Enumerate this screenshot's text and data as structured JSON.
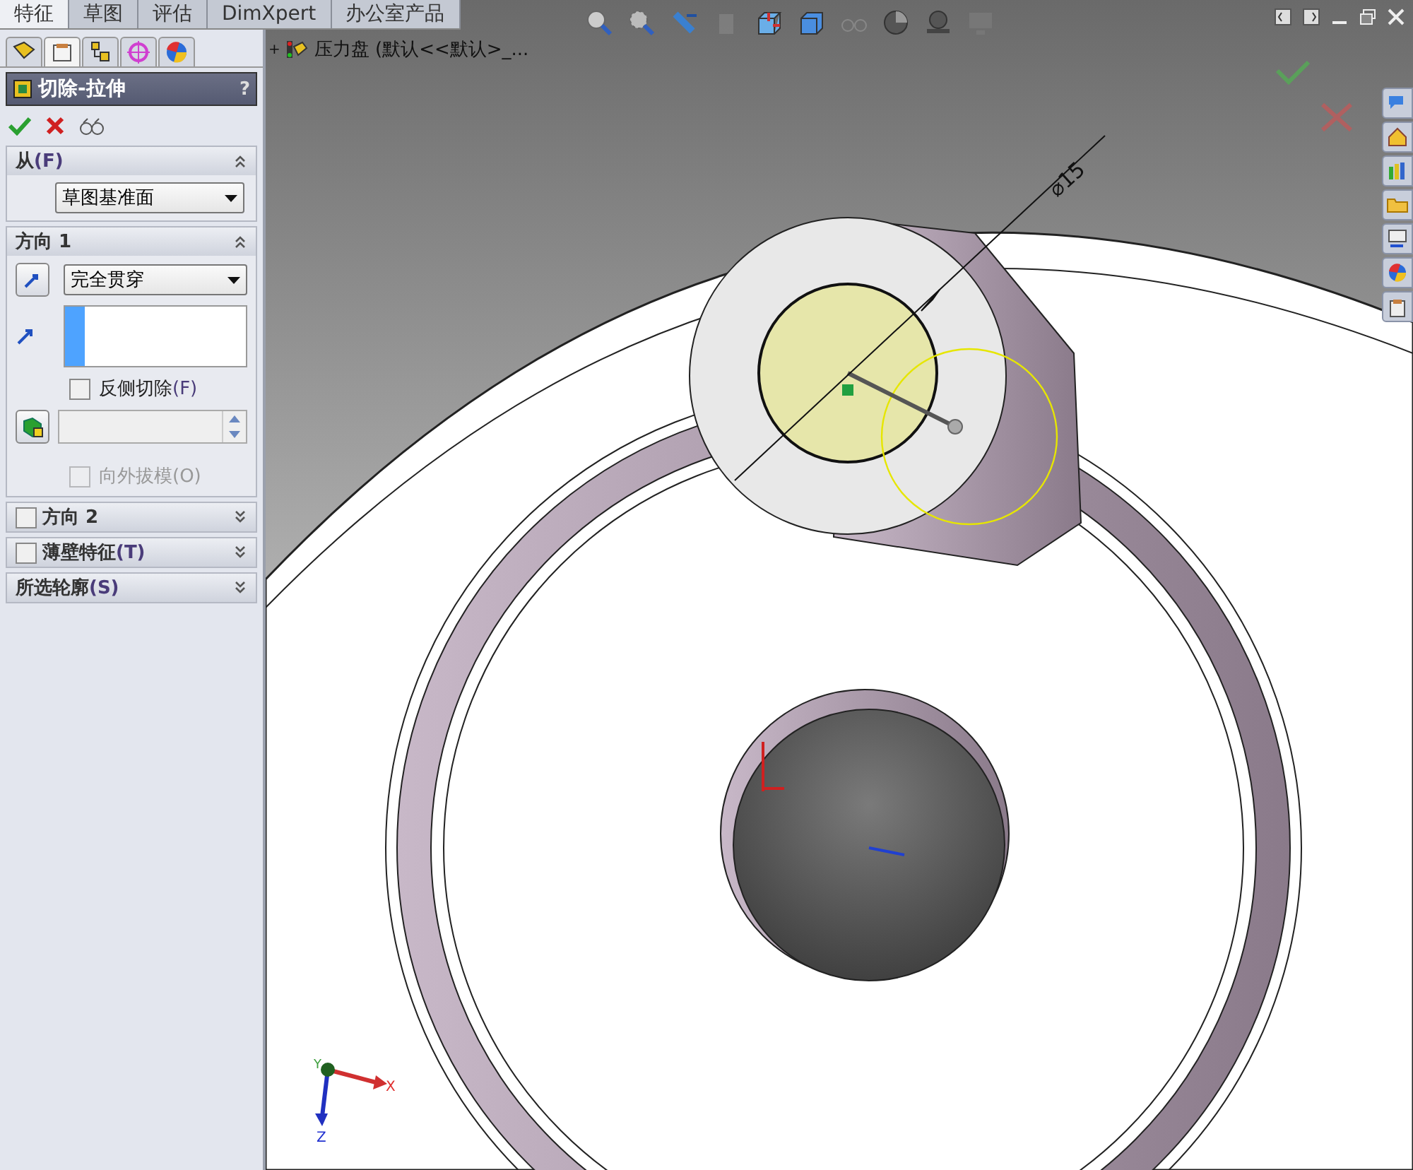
{
  "command_tabs": [
    {
      "label": "特征",
      "selected": true
    },
    {
      "label": "草图",
      "selected": false
    },
    {
      "label": "评估",
      "selected": false
    },
    {
      "label": "DimXpert",
      "selected": false
    },
    {
      "label": "办公室产品",
      "selected": false
    }
  ],
  "manager_tabs": [
    {
      "kind": "feature",
      "selected": false
    },
    {
      "kind": "property",
      "selected": true
    },
    {
      "kind": "config",
      "selected": false
    },
    {
      "kind": "dimxpert",
      "selected": false
    },
    {
      "kind": "display",
      "selected": false
    }
  ],
  "property_manager": {
    "title": "切除-拉伸",
    "help": "?"
  },
  "sections": [
    {
      "kind": "from",
      "title": "从",
      "key": "(F)",
      "expanded": true,
      "value": "草图基准面"
    },
    {
      "kind": "direction",
      "title": "方向 1",
      "expanded": true,
      "value": "完全贯穿",
      "flip": {
        "label": "反侧切除",
        "key": "(F)",
        "checked": false,
        "disabled": false
      },
      "draft": {
        "label": "向外拔模",
        "key": "(O)",
        "checked": false,
        "disabled": true
      }
    },
    {
      "kind": "optional",
      "title": "方向 2",
      "checked": false,
      "expanded": false
    },
    {
      "kind": "optional",
      "title": "薄壁特征",
      "key": "(T)",
      "checked": false,
      "expanded": false
    },
    {
      "kind": "plain",
      "title": "所选轮廓",
      "key": "(S)",
      "expanded": false
    }
  ],
  "tree": {
    "expander": "+",
    "label": "压力盘 (默认<<默认>_..."
  },
  "dimension": "⌀15",
  "triad": {
    "x": "X",
    "y": "Y",
    "z": "Z"
  }
}
